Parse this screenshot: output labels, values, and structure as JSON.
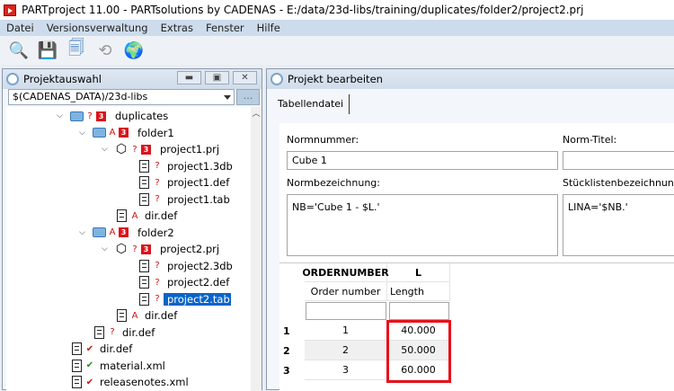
{
  "title": "PARTproject 11.00 - PARTsolutions by CADENAS - E:/data/23d-libs/training/duplicates/folder2/project2.prj",
  "menu": [
    "Datei",
    "Versionsverwaltung",
    "Extras",
    "Fenster",
    "Hilfe"
  ],
  "toolbar": [
    "search-text-icon",
    "save-icon",
    "save-all-icon",
    "refresh-icon",
    "globe-icon"
  ],
  "left_panel": {
    "title": "Projektauswahl",
    "path": "$(CADENAS_DATA)/23d-libs",
    "more": "...",
    "tree": [
      {
        "depth": 0,
        "type": "folder",
        "chev": true,
        "mark": "?",
        "b3": true,
        "label": "duplicates"
      },
      {
        "depth": 1,
        "type": "folder",
        "chev": true,
        "mark": "A",
        "b3": true,
        "label": "folder1"
      },
      {
        "depth": 2,
        "type": "cube",
        "chev": true,
        "mark": "?",
        "b3": true,
        "label": "project1.prj"
      },
      {
        "depth": 3,
        "type": "file",
        "mark": "?",
        "label": "project1.3db"
      },
      {
        "depth": 3,
        "type": "file",
        "mark": "?",
        "label": "project1.def"
      },
      {
        "depth": 3,
        "type": "file",
        "mark": "?",
        "label": "project1.tab"
      },
      {
        "depth": 2,
        "type": "file",
        "mark": "A",
        "label": "dir.def"
      },
      {
        "depth": 1,
        "type": "folder",
        "chev": true,
        "mark": "A",
        "b3": true,
        "label": "folder2"
      },
      {
        "depth": 2,
        "type": "cube",
        "chev": true,
        "mark": "?",
        "b3": true,
        "label": "project2.prj"
      },
      {
        "depth": 3,
        "type": "file",
        "mark": "?",
        "label": "project2.3db"
      },
      {
        "depth": 3,
        "type": "file",
        "mark": "?",
        "label": "project2.def"
      },
      {
        "depth": 3,
        "type": "file",
        "mark": "?",
        "label": "project2.tab",
        "selected": true
      },
      {
        "depth": 2,
        "type": "file",
        "mark": "A",
        "label": "dir.def"
      },
      {
        "depth": 1,
        "type": "file",
        "mark": "?",
        "label": "dir.def"
      },
      {
        "depth": 0,
        "type": "file",
        "mark": "✔",
        "label": "dir.def",
        "markColor": "#d01010"
      },
      {
        "depth": 0,
        "type": "file",
        "mark": "✔",
        "label": "material.xml",
        "markColor": "#2a8a2a"
      },
      {
        "depth": 0,
        "type": "file",
        "mark": "✔",
        "label": "releasenotes.xml",
        "markColor": "#d01010"
      }
    ]
  },
  "right_panel": {
    "title": "Projekt bearbeiten",
    "tab": "Tabellendatei",
    "normnummer_label": "Normnummer:",
    "normnummer": "Cube 1",
    "normtitel_label": "Norm-Titel:",
    "normtitel": "",
    "normbez_label": "Normbezeichnung:",
    "normbez": "NB='Cube 1 - $L.'",
    "stueck_label": "Stücklistenbezeichnung:",
    "stueck": "LINA='$NB.'",
    "table": {
      "columns": [
        {
          "name": "ORDERNUMBER",
          "desc": "Order number"
        },
        {
          "name": "L",
          "desc": "Length"
        }
      ],
      "rows": [
        {
          "n": "1",
          "cells": [
            "1",
            "40.000"
          ]
        },
        {
          "n": "2",
          "cells": [
            "2",
            "50.000"
          ]
        },
        {
          "n": "3",
          "cells": [
            "3",
            "60.000"
          ]
        }
      ],
      "highlight_color": "#e8101a"
    }
  }
}
